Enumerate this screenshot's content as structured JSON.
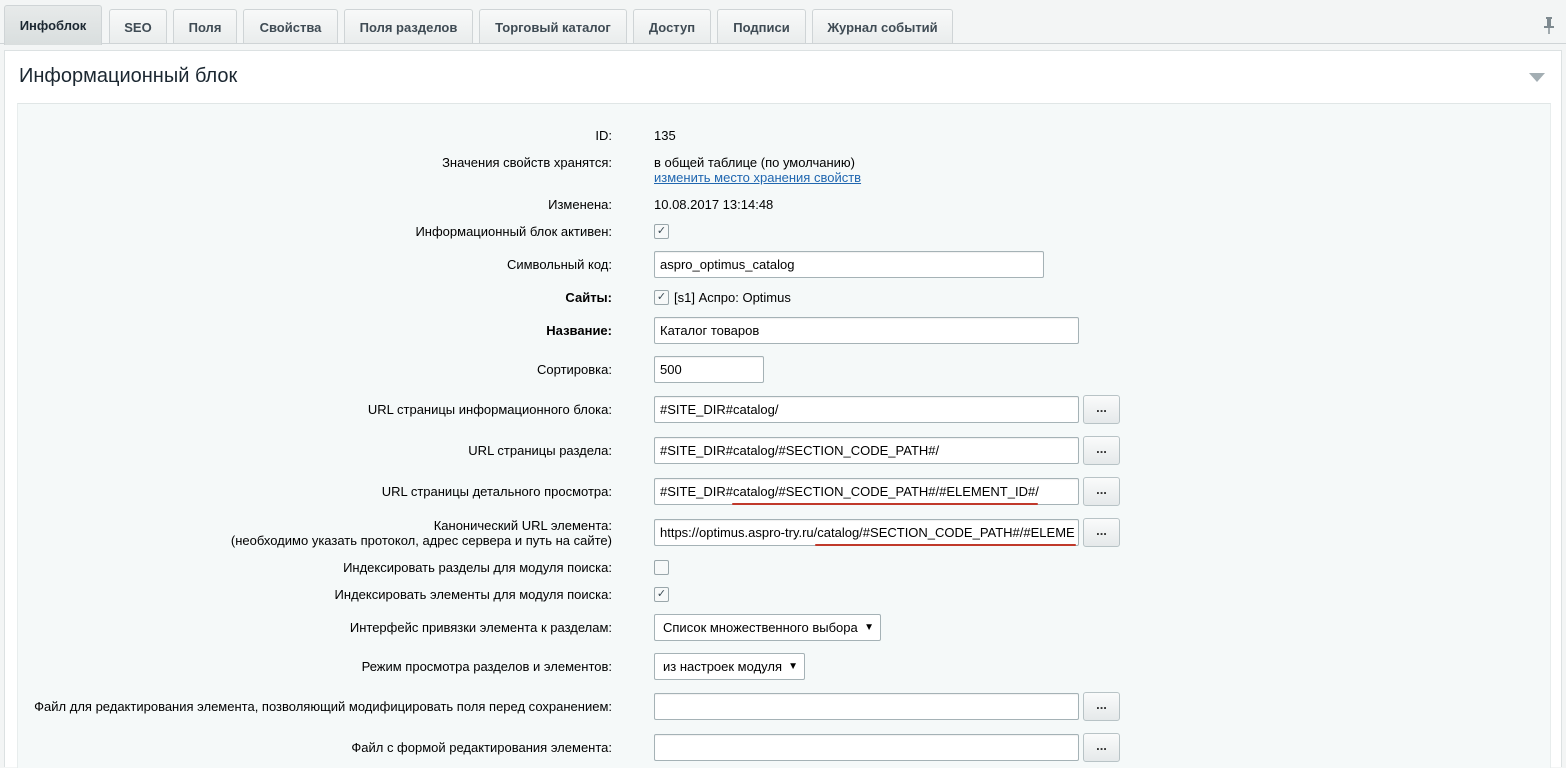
{
  "tabs": [
    {
      "label": "Инфоблок",
      "active": true
    },
    {
      "label": "SEO",
      "active": false
    },
    {
      "label": "Поля",
      "active": false
    },
    {
      "label": "Свойства",
      "active": false
    },
    {
      "label": "Поля разделов",
      "active": false
    },
    {
      "label": "Торговый каталог",
      "active": false
    },
    {
      "label": "Доступ",
      "active": false
    },
    {
      "label": "Подписи",
      "active": false
    },
    {
      "label": "Журнал событий",
      "active": false
    }
  ],
  "panel": {
    "title": "Информационный блок"
  },
  "fields": {
    "id_label": "ID:",
    "id_value": "135",
    "storage_label": "Значения свойств хранятся:",
    "storage_value": "в общей таблице (по умолчанию)",
    "storage_link": "изменить место хранения свойств",
    "modified_label": "Изменена:",
    "modified_value": "10.08.2017 13:14:48",
    "active_label": "Информационный блок активен:",
    "active_checked": true,
    "code_label": "Символьный код:",
    "code_value": "aspro_optimus_catalog",
    "sites_label": "Сайты:",
    "sites_checked": true,
    "sites_value": "[s1] Аспро: Optimus",
    "name_label": "Название:",
    "name_value": "Каталог товаров",
    "sort_label": "Сортировка:",
    "sort_value": "500",
    "list_url_label": "URL страницы информационного блока:",
    "list_url_value": "#SITE_DIR#catalog/",
    "section_url_label": "URL страницы раздела:",
    "section_url_value": "#SITE_DIR#catalog/#SECTION_CODE_PATH#/",
    "detail_url_label": "URL страницы детального просмотра:",
    "detail_url_value": "#SITE_DIR#catalog/#SECTION_CODE_PATH#/#ELEMENT_ID#/",
    "canonical_label": "Канонический URL элемента:",
    "canonical_sublabel": "(необходимо указать протокол, адрес сервера и путь на сайте)",
    "canonical_value": "https://optimus.aspro-try.ru/catalog/#SECTION_CODE_PATH#/#ELEME",
    "index_sections_label": "Индексировать разделы для модуля поиска:",
    "index_sections_checked": false,
    "index_elements_label": "Индексировать элементы для модуля поиска:",
    "index_elements_checked": true,
    "section_binding_label": "Интерфейс привязки элемента к разделам:",
    "section_binding_value": "Список множественного выбора",
    "view_mode_label": "Режим просмотра разделов и элементов:",
    "view_mode_value": "из настроек модуля",
    "edit_file_label": "Файл для редактирования элемента, позволяющий модифицировать поля перед сохранением:",
    "edit_file_value": "",
    "form_file_label": "Файл с формой редактирования элемента:",
    "form_file_value": "",
    "dots_label": "..."
  },
  "icons": {
    "pin": "pin-icon",
    "collapse": "collapse-arrow-icon",
    "check": "✓",
    "dropdown": "▼"
  },
  "colors": {
    "link": "#2067b0",
    "underline_mark": "#c0392b"
  }
}
